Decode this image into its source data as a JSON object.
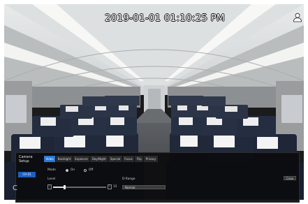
{
  "overlay": {
    "timestamp": "2019-01-01 01:10:25 PM",
    "user_icon": "user-icon"
  },
  "camera_setup": {
    "title_line1": "Camera",
    "title_line2": "Setup",
    "channel_label": "CH 01",
    "partial_letter": "C",
    "tabs": [
      "Video",
      "Backlight",
      "Exposure",
      "Day/Night",
      "Special",
      "Focus",
      "Flip",
      "Privacy"
    ],
    "active_tab": "Video",
    "mode_label": "Mode",
    "mode_options": [
      "On",
      "Off"
    ],
    "mode_selected": "On",
    "level_label": "Level",
    "level_value": "15",
    "level_fraction": 0.22,
    "dnr_label": "D-Range",
    "dnr_value": "Normal",
    "close_label": "Close"
  }
}
